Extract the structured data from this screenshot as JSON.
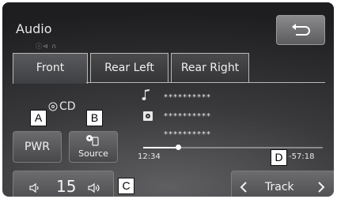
{
  "header": {
    "title": "Audio",
    "hint_icons": "ⓘ⊲ ∩"
  },
  "tabs": [
    {
      "label": "Front",
      "active": true
    },
    {
      "label": "Rear Left",
      "active": false
    },
    {
      "label": "Rear Right",
      "active": false
    }
  ],
  "callouts": {
    "a": "A",
    "b": "B",
    "c": "C",
    "d": "D"
  },
  "source_label": "CD",
  "buttons": {
    "pwr": "PWR",
    "source": "Source",
    "track": "Track"
  },
  "track_info": {
    "title": "**********",
    "disc": "**********",
    "artist": "**********"
  },
  "time": {
    "elapsed": "12:34",
    "remaining": "-57:18",
    "progress": 0.18
  },
  "volume": {
    "level": "15"
  },
  "colors": {
    "background": "#2e2e31",
    "accent": "#ffffff"
  }
}
